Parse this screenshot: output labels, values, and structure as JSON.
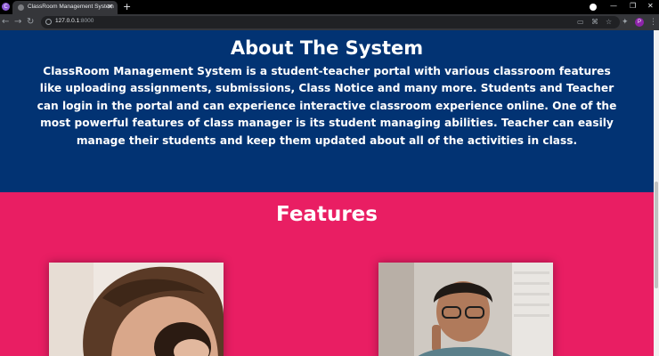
{
  "browser": {
    "tab_title": "ClassRoom Management System",
    "url_host": "127.0.0.1",
    "url_port": ":8000",
    "profile_initial": "P",
    "profile_dot_letter": "C"
  },
  "about": {
    "title": "About The System",
    "text": "ClassRoom Management System is a student-teacher portal with various classroom features like uploading assignments, submissions, Class Notice and many more. Students and Teacher can login in the portal and can experience interactive classroom experience online. One of the most powerful features of class manager is its student managing abilities. Teacher can easily manage their students and keep them updated about all of the activities in class."
  },
  "features": {
    "title": "Features"
  },
  "colors": {
    "about_bg": "#023373",
    "features_bg": "#e91e63",
    "chrome_dark": "#000000",
    "chrome_toolbar": "#35363a"
  }
}
